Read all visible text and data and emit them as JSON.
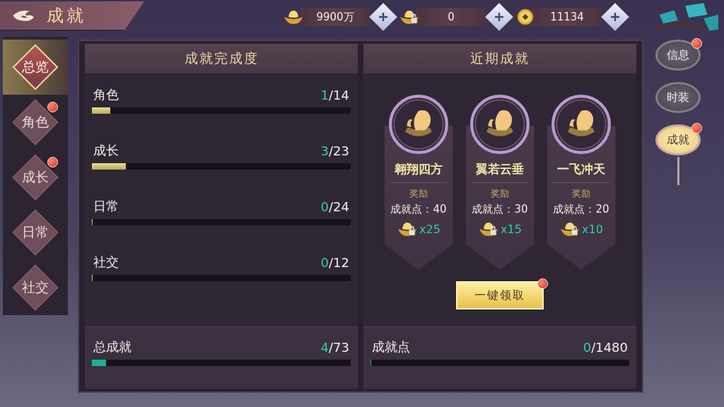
{
  "header": {
    "title": "成就"
  },
  "currencies": [
    {
      "kind": "ingot",
      "amount": "9900万"
    },
    {
      "kind": "locked-ingot",
      "amount": "0"
    },
    {
      "kind": "coin",
      "amount": "11134"
    }
  ],
  "sidebar": {
    "items": [
      {
        "label": "总览",
        "selected": true,
        "badge": false
      },
      {
        "label": "角色",
        "selected": false,
        "badge": true
      },
      {
        "label": "成长",
        "selected": false,
        "badge": true
      },
      {
        "label": "日常",
        "selected": false,
        "badge": false
      },
      {
        "label": "社交",
        "selected": false,
        "badge": false
      }
    ]
  },
  "progress_panel": {
    "title": "成就完成度",
    "categories": [
      {
        "name": "角色",
        "done": "1",
        "total": "/14",
        "level": 0.07
      },
      {
        "name": "成长",
        "done": "3",
        "total": "/23",
        "level": 0.13
      },
      {
        "name": "日常",
        "done": "0",
        "total": "/24",
        "level": 0
      },
      {
        "name": "社交",
        "done": "0",
        "total": "/12",
        "level": 0
      }
    ],
    "total": {
      "name": "总成就",
      "done": "4",
      "total": "/73",
      "level": 0.055
    }
  },
  "recent_panel": {
    "title": "近期成就",
    "achievements": [
      {
        "name": "翱翔四方",
        "reward_label": "奖励",
        "points": "成就点：40",
        "reward_count": "x25"
      },
      {
        "name": "翼若云垂",
        "reward_label": "奖励",
        "points": "成就点：30",
        "reward_count": "x15"
      },
      {
        "name": "一飞冲天",
        "reward_label": "奖励",
        "points": "成就点：20",
        "reward_count": "x10"
      }
    ],
    "claim_button": {
      "label": "一键领取",
      "badge": true
    },
    "points": {
      "name": "成就点",
      "done": "0",
      "total": "/1480",
      "level": 0
    }
  },
  "right_tabs": [
    {
      "label": "信息",
      "selected": false,
      "badge": true
    },
    {
      "label": "时装",
      "selected": false,
      "badge": false
    },
    {
      "label": "成就",
      "selected": true,
      "badge": true
    }
  ]
}
